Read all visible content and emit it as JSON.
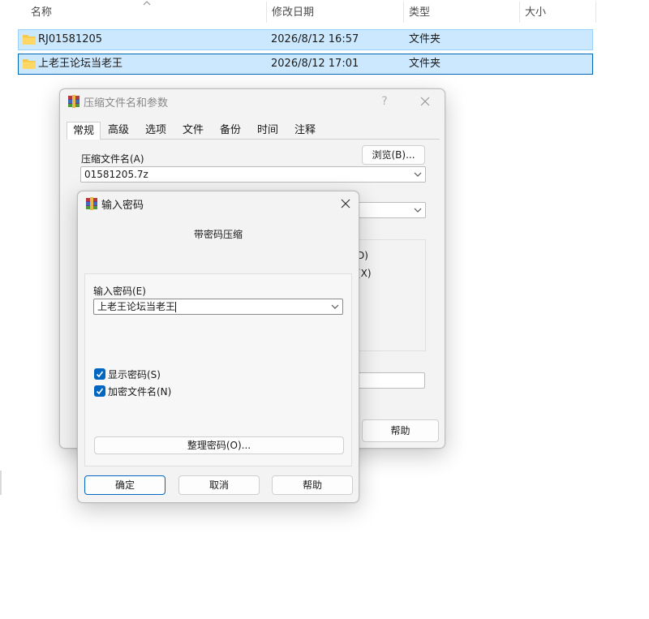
{
  "explorer": {
    "columns": {
      "name": "名称",
      "date": "修改日期",
      "type": "类型",
      "size": "大小"
    },
    "rows": [
      {
        "name": "RJ01581205",
        "date": "2026/8/12 16:57",
        "type": "文件夹"
      },
      {
        "name": "上老王论坛当老王",
        "date": "2026/8/12 17:01",
        "type": "文件夹"
      }
    ]
  },
  "archive_dialog": {
    "title": "压缩文件名和参数",
    "help_icon": "?",
    "tabs": [
      "常规",
      "高级",
      "选项",
      "文件",
      "备份",
      "时间",
      "注释"
    ],
    "filename_label": "压缩文件名(A)",
    "browse_button": "浏览(B)...",
    "filename_value": "01581205.7z",
    "partial_text_1": "D)",
    "partial_text_2": "(X)",
    "help_button": "帮助"
  },
  "password_dialog": {
    "title": "输入密码",
    "heading": "带密码压缩",
    "password_label": "输入密码(E)",
    "password_value": "上老王论坛当老王",
    "show_password_label": "显示密码(S)",
    "show_password_checked": true,
    "encrypt_names_label": "加密文件名(N)",
    "encrypt_names_checked": true,
    "organize_button": "整理密码(O)...",
    "ok_button": "确定",
    "cancel_button": "取消",
    "help_button": "帮助"
  },
  "colors": {
    "selection_bg": "#cce8ff",
    "selection_border": "#99d1ff",
    "accent": "#0067c0",
    "folder": "#f7c948"
  }
}
